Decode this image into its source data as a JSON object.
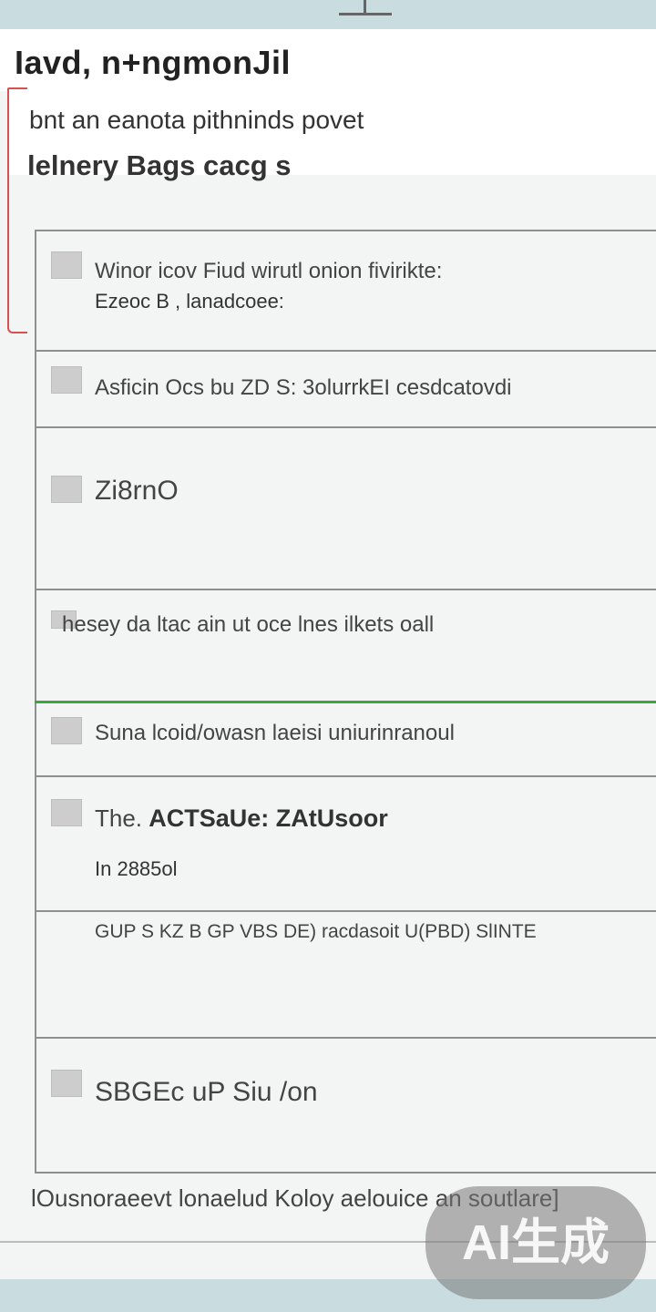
{
  "header": {
    "title": "Iavd, n+ngmonJil"
  },
  "intro": {
    "line": "bnt an eanota pithninds povet",
    "subtitle": "lelnery   Bags cacg s"
  },
  "list": {
    "items": [
      {
        "line1": "Winor icov Fiud wirutl onion fivirikte:",
        "line2": "Ezeoc B ,   lanadcoee:",
        "checkbox": true
      },
      {
        "line1": "Asficin Ocs bu ZD S: 3olurrkEI cesdcatovdi",
        "checkbox": true
      },
      {
        "line1": "Zi8rnO",
        "checkbox": true
      },
      {
        "line1": "hesey da ltac ain ut oce lnes ilkets oall",
        "checkbox": true
      },
      {
        "line1": "Suna lcoid/owasn laeisi uniurinranoul",
        "checkbox": true
      },
      {
        "line1": "The.",
        "line1_bold": "ACTSaUe:  ZAtUsoor",
        "line2": "In 2885ol",
        "checkbox": true
      },
      {
        "line1": "GUP S KZ  B  GP   VBS DE) racdasoit U(PBD) SlINTE",
        "checkbox": false
      },
      {
        "line1": "SBGEc uP  Siu /on",
        "checkbox": true
      }
    ]
  },
  "footer": {
    "text": "lOusnoraeevt lonaelud Koloy aelouice an soutlare]"
  },
  "badge": {
    "label": "AI生成"
  },
  "colors": {
    "accent_green": "#3da53d",
    "accent_red": "#d95050",
    "strip": "#c9dde0"
  }
}
